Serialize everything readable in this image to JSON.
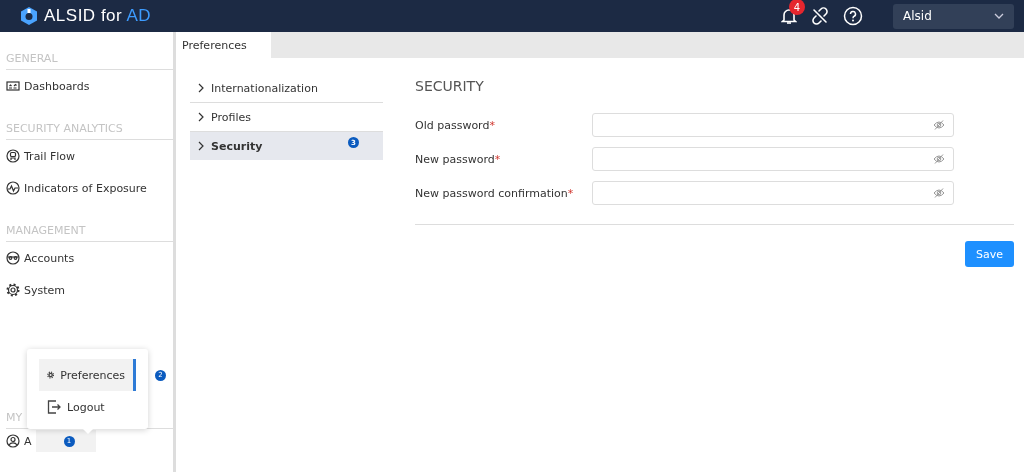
{
  "topbar": {
    "logo": {
      "brand": "ALSID",
      "joiner": "for",
      "product": "AD"
    },
    "notifications": {
      "count": "4"
    },
    "user_menu": {
      "value": "Alsid"
    }
  },
  "sidebar": {
    "sections": [
      {
        "title": "GENERAL",
        "items": [
          {
            "label": "Dashboards"
          }
        ]
      },
      {
        "title": "SECURITY ANALYTICS",
        "items": [
          {
            "label": "Trail Flow"
          },
          {
            "label": "Indicators of Exposure"
          }
        ]
      },
      {
        "title": "MANAGEMENT",
        "items": [
          {
            "label": "Accounts"
          },
          {
            "label": "System"
          }
        ]
      },
      {
        "title": "MY",
        "items": [
          {
            "label": "A",
            "badge": "1"
          }
        ]
      }
    ]
  },
  "popup_menu": {
    "items": [
      {
        "label": "Preferences",
        "selected": true,
        "badge": "2"
      },
      {
        "label": "Logout",
        "selected": false
      }
    ]
  },
  "tabs": [
    {
      "label": "Preferences",
      "selected": true
    }
  ],
  "preferences_menu": [
    {
      "label": "Internationalization",
      "selected": false
    },
    {
      "label": "Profiles",
      "selected": false
    },
    {
      "label": "Security",
      "selected": true,
      "badge": "3"
    }
  ],
  "form": {
    "title": "SECURITY",
    "fields": [
      {
        "label": "Old password",
        "required_mark": "*"
      },
      {
        "label": "New password",
        "required_mark": "*"
      },
      {
        "label": "New password confirmation",
        "required_mark": "*"
      }
    ],
    "submit": "Save"
  }
}
